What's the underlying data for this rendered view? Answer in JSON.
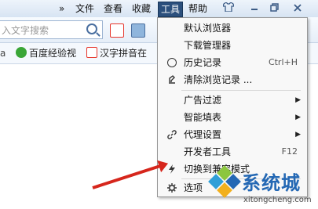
{
  "menubar": {
    "overflow": "»",
    "items": [
      "文件",
      "查看",
      "收藏",
      "工具",
      "帮助"
    ],
    "active": "工具",
    "window_buttons": [
      "shirt-icon",
      "minimize-icon",
      "restore-icon",
      "close-icon"
    ]
  },
  "search": {
    "placeholder": "入文字搜索"
  },
  "favorites": [
    {
      "label": "百度经验视",
      "icon": "play-icon",
      "color": "#e6352b"
    },
    {
      "label": "汉字拼音在",
      "icon": "z-icon",
      "color": "#e6352b"
    }
  ],
  "favorites_prefix": "a",
  "tools_menu": {
    "items": [
      {
        "label": "默认浏览器",
        "shortcut": "",
        "icon": "",
        "submenu": false
      },
      {
        "label": "下载管理器",
        "shortcut": "",
        "icon": "",
        "submenu": false
      },
      {
        "label": "历史记录",
        "shortcut": "Ctrl+H",
        "icon": "clock-icon",
        "submenu": false
      },
      {
        "label": "清除浏览记录 ...",
        "shortcut": "",
        "icon": "eraser-icon",
        "submenu": false
      },
      {
        "label": "广告过滤",
        "shortcut": "",
        "icon": "",
        "submenu": true
      },
      {
        "label": "智能填表",
        "shortcut": "",
        "icon": "",
        "submenu": true
      },
      {
        "label": "代理设置",
        "shortcut": "",
        "icon": "link-icon",
        "submenu": true
      },
      {
        "label": "开发者工具",
        "shortcut": "F12",
        "icon": "",
        "submenu": false
      },
      {
        "label": "切换到兼容模式",
        "shortcut": "",
        "icon": "lightning-icon",
        "submenu": false
      },
      {
        "label": "选项",
        "shortcut": "",
        "icon": "gear-icon",
        "submenu": false
      }
    ]
  },
  "watermark": {
    "brand": "系统城",
    "url": "xitongcheng.com"
  },
  "colors": {
    "accent": "#2b4f7c",
    "annotation_arrow": "#d6261c",
    "brand": "#2468b4"
  }
}
